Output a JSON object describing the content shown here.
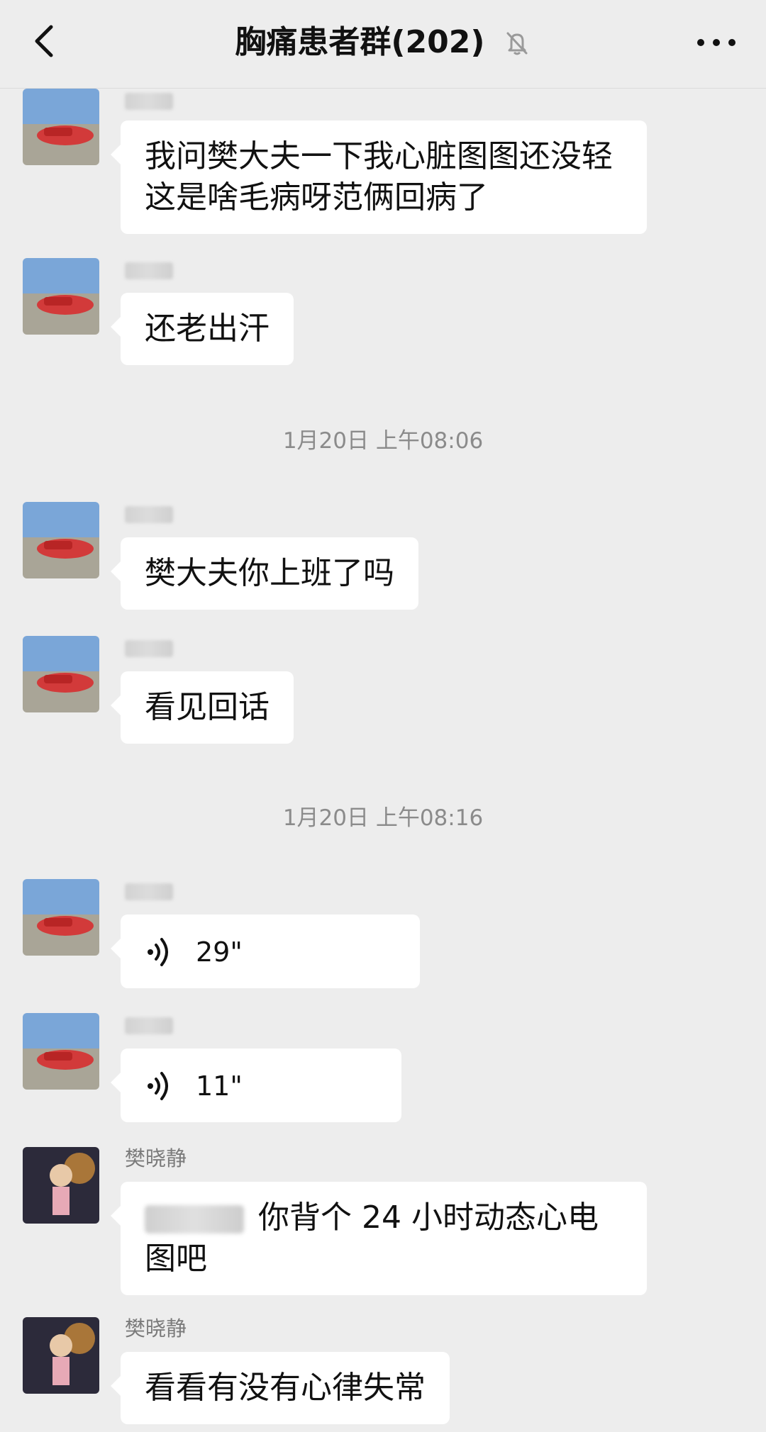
{
  "header": {
    "title": "胸痛患者群(202)"
  },
  "timestamps": [
    "1月20日 上午08:06",
    "1月20日 上午08:16"
  ],
  "messages": [
    {
      "sender": "",
      "text": "我问樊大夫一下我心脏图图还没轻这是啥毛病呀范俩回病了"
    },
    {
      "sender": "",
      "text": "还老出汗"
    },
    {
      "sender": "",
      "text": "樊大夫你上班了吗"
    },
    {
      "sender": "",
      "text": "看见回话"
    },
    {
      "sender": "",
      "duration": "29\""
    },
    {
      "sender": "",
      "duration": "11\""
    },
    {
      "sender": "樊晓静",
      "text": "你背个 24 小时动态心电图吧"
    },
    {
      "sender": "樊晓静",
      "text": "看看有没有心律失常"
    }
  ],
  "colors": {
    "background": "#ededed",
    "bubble": "#ffffff",
    "sender_text": "#7b7b7b",
    "timestamp_text": "#8b8b8b"
  },
  "icons": {
    "back": "back-chevron-icon",
    "mute": "bell-off-icon",
    "more": "more-dots-icon",
    "voice": "voice-waves-icon"
  }
}
